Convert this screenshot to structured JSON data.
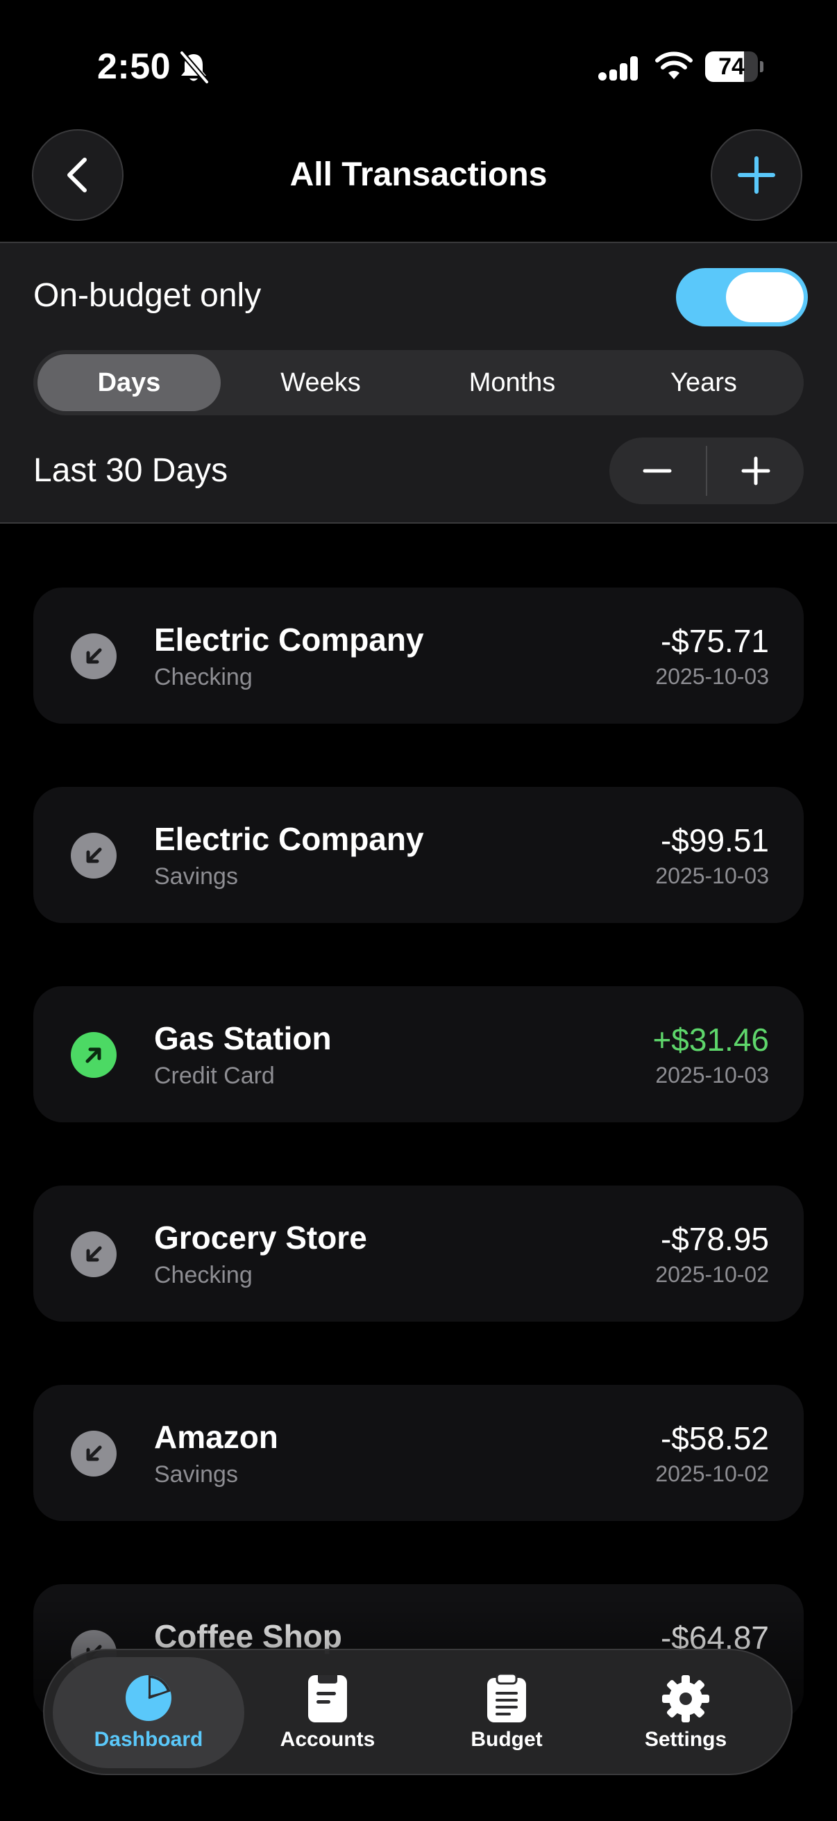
{
  "status_bar": {
    "time": "2:50",
    "battery_percent": 74,
    "battery_label": "74",
    "icons": [
      "bell-slash-icon",
      "cellular-signal-icon",
      "wifi-icon",
      "battery-icon"
    ]
  },
  "header": {
    "title": "All Transactions",
    "back_icon": "chevron-left-icon",
    "add_icon": "plus-icon"
  },
  "filters": {
    "toggle_label": "On-budget only",
    "toggle_on": true,
    "periods": [
      "Days",
      "Weeks",
      "Months",
      "Years"
    ],
    "selected_period": "Days",
    "range_label": "Last 30 Days",
    "stepper_icons": [
      "minus-icon",
      "plus-icon"
    ]
  },
  "transactions": [
    {
      "name": "Electric Company",
      "account": "Checking",
      "amount": "-$75.71",
      "date": "2025-10-03",
      "direction": "out"
    },
    {
      "name": "Electric Company",
      "account": "Savings",
      "amount": "-$99.51",
      "date": "2025-10-03",
      "direction": "out"
    },
    {
      "name": "Gas Station",
      "account": "Credit Card",
      "amount": "+$31.46",
      "date": "2025-10-03",
      "direction": "in"
    },
    {
      "name": "Grocery Store",
      "account": "Checking",
      "amount": "-$78.95",
      "date": "2025-10-02",
      "direction": "out"
    },
    {
      "name": "Amazon",
      "account": "Savings",
      "amount": "-$58.52",
      "date": "2025-10-02",
      "direction": "out"
    },
    {
      "name": "Coffee Shop",
      "account": "",
      "amount": "-$64.87",
      "date": "",
      "direction": "out"
    }
  ],
  "tab_bar": {
    "items": [
      {
        "label": "Dashboard",
        "icon": "pie-chart-icon",
        "active": true
      },
      {
        "label": "Accounts",
        "icon": "document-icon",
        "active": false
      },
      {
        "label": "Budget",
        "icon": "clipboard-icon",
        "active": false
      },
      {
        "label": "Settings",
        "icon": "gear-icon",
        "active": false
      }
    ]
  },
  "colors": {
    "accent": "#5ac8fa",
    "positive": "#5ed66b",
    "card": "#111113",
    "panel": "#1c1c1e"
  }
}
